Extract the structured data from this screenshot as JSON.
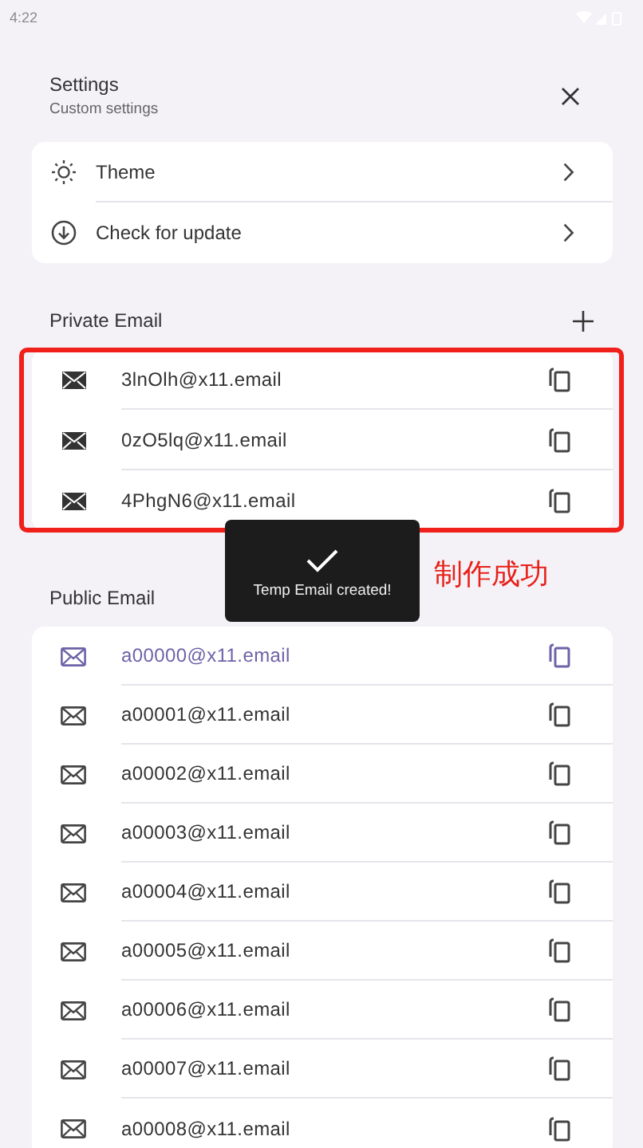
{
  "status_bar": {
    "time": "4:22"
  },
  "header": {
    "title": "Settings",
    "subtitle": "Custom settings"
  },
  "menu": [
    {
      "kind": "theme",
      "label": "Theme"
    },
    {
      "kind": "update",
      "label": "Check for update"
    }
  ],
  "private_email": {
    "title": "Private Email",
    "addresses": [
      {
        "address": "3lnOlh@x11.email"
      },
      {
        "address": "0zO5lq@x11.email"
      },
      {
        "address": "4PhgN6@x11.email"
      }
    ]
  },
  "public_email": {
    "title": "Public Email",
    "addresses": [
      {
        "address": "a00000@x11.email",
        "selected": true
      },
      {
        "address": "a00001@x11.email",
        "selected": false
      },
      {
        "address": "a00002@x11.email",
        "selected": false
      },
      {
        "address": "a00003@x11.email",
        "selected": false
      },
      {
        "address": "a00004@x11.email",
        "selected": false
      },
      {
        "address": "a00005@x11.email",
        "selected": false
      },
      {
        "address": "a00006@x11.email",
        "selected": false
      },
      {
        "address": "a00007@x11.email",
        "selected": false
      },
      {
        "address": "a00008@x11.email",
        "selected": false
      }
    ]
  },
  "toast": {
    "message": "Temp Email created!"
  },
  "annotation": {
    "text": "制作成功"
  }
}
